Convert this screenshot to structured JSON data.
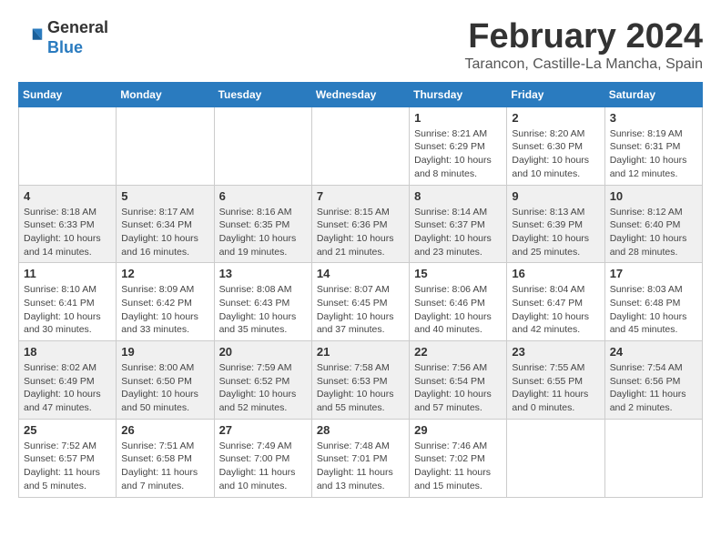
{
  "logo": {
    "general": "General",
    "blue": "Blue"
  },
  "title": {
    "month": "February 2024",
    "location": "Tarancon, Castille-La Mancha, Spain"
  },
  "weekdays": [
    "Sunday",
    "Monday",
    "Tuesday",
    "Wednesday",
    "Thursday",
    "Friday",
    "Saturday"
  ],
  "weeks": [
    {
      "days": [
        {
          "num": "",
          "info": ""
        },
        {
          "num": "",
          "info": ""
        },
        {
          "num": "",
          "info": ""
        },
        {
          "num": "",
          "info": ""
        },
        {
          "num": "1",
          "info": "Sunrise: 8:21 AM\nSunset: 6:29 PM\nDaylight: 10 hours\nand 8 minutes."
        },
        {
          "num": "2",
          "info": "Sunrise: 8:20 AM\nSunset: 6:30 PM\nDaylight: 10 hours\nand 10 minutes."
        },
        {
          "num": "3",
          "info": "Sunrise: 8:19 AM\nSunset: 6:31 PM\nDaylight: 10 hours\nand 12 minutes."
        }
      ]
    },
    {
      "days": [
        {
          "num": "4",
          "info": "Sunrise: 8:18 AM\nSunset: 6:33 PM\nDaylight: 10 hours\nand 14 minutes."
        },
        {
          "num": "5",
          "info": "Sunrise: 8:17 AM\nSunset: 6:34 PM\nDaylight: 10 hours\nand 16 minutes."
        },
        {
          "num": "6",
          "info": "Sunrise: 8:16 AM\nSunset: 6:35 PM\nDaylight: 10 hours\nand 19 minutes."
        },
        {
          "num": "7",
          "info": "Sunrise: 8:15 AM\nSunset: 6:36 PM\nDaylight: 10 hours\nand 21 minutes."
        },
        {
          "num": "8",
          "info": "Sunrise: 8:14 AM\nSunset: 6:37 PM\nDaylight: 10 hours\nand 23 minutes."
        },
        {
          "num": "9",
          "info": "Sunrise: 8:13 AM\nSunset: 6:39 PM\nDaylight: 10 hours\nand 25 minutes."
        },
        {
          "num": "10",
          "info": "Sunrise: 8:12 AM\nSunset: 6:40 PM\nDaylight: 10 hours\nand 28 minutes."
        }
      ]
    },
    {
      "days": [
        {
          "num": "11",
          "info": "Sunrise: 8:10 AM\nSunset: 6:41 PM\nDaylight: 10 hours\nand 30 minutes."
        },
        {
          "num": "12",
          "info": "Sunrise: 8:09 AM\nSunset: 6:42 PM\nDaylight: 10 hours\nand 33 minutes."
        },
        {
          "num": "13",
          "info": "Sunrise: 8:08 AM\nSunset: 6:43 PM\nDaylight: 10 hours\nand 35 minutes."
        },
        {
          "num": "14",
          "info": "Sunrise: 8:07 AM\nSunset: 6:45 PM\nDaylight: 10 hours\nand 37 minutes."
        },
        {
          "num": "15",
          "info": "Sunrise: 8:06 AM\nSunset: 6:46 PM\nDaylight: 10 hours\nand 40 minutes."
        },
        {
          "num": "16",
          "info": "Sunrise: 8:04 AM\nSunset: 6:47 PM\nDaylight: 10 hours\nand 42 minutes."
        },
        {
          "num": "17",
          "info": "Sunrise: 8:03 AM\nSunset: 6:48 PM\nDaylight: 10 hours\nand 45 minutes."
        }
      ]
    },
    {
      "days": [
        {
          "num": "18",
          "info": "Sunrise: 8:02 AM\nSunset: 6:49 PM\nDaylight: 10 hours\nand 47 minutes."
        },
        {
          "num": "19",
          "info": "Sunrise: 8:00 AM\nSunset: 6:50 PM\nDaylight: 10 hours\nand 50 minutes."
        },
        {
          "num": "20",
          "info": "Sunrise: 7:59 AM\nSunset: 6:52 PM\nDaylight: 10 hours\nand 52 minutes."
        },
        {
          "num": "21",
          "info": "Sunrise: 7:58 AM\nSunset: 6:53 PM\nDaylight: 10 hours\nand 55 minutes."
        },
        {
          "num": "22",
          "info": "Sunrise: 7:56 AM\nSunset: 6:54 PM\nDaylight: 10 hours\nand 57 minutes."
        },
        {
          "num": "23",
          "info": "Sunrise: 7:55 AM\nSunset: 6:55 PM\nDaylight: 11 hours\nand 0 minutes."
        },
        {
          "num": "24",
          "info": "Sunrise: 7:54 AM\nSunset: 6:56 PM\nDaylight: 11 hours\nand 2 minutes."
        }
      ]
    },
    {
      "days": [
        {
          "num": "25",
          "info": "Sunrise: 7:52 AM\nSunset: 6:57 PM\nDaylight: 11 hours\nand 5 minutes."
        },
        {
          "num": "26",
          "info": "Sunrise: 7:51 AM\nSunset: 6:58 PM\nDaylight: 11 hours\nand 7 minutes."
        },
        {
          "num": "27",
          "info": "Sunrise: 7:49 AM\nSunset: 7:00 PM\nDaylight: 11 hours\nand 10 minutes."
        },
        {
          "num": "28",
          "info": "Sunrise: 7:48 AM\nSunset: 7:01 PM\nDaylight: 11 hours\nand 13 minutes."
        },
        {
          "num": "29",
          "info": "Sunrise: 7:46 AM\nSunset: 7:02 PM\nDaylight: 11 hours\nand 15 minutes."
        },
        {
          "num": "",
          "info": ""
        },
        {
          "num": "",
          "info": ""
        }
      ]
    }
  ]
}
